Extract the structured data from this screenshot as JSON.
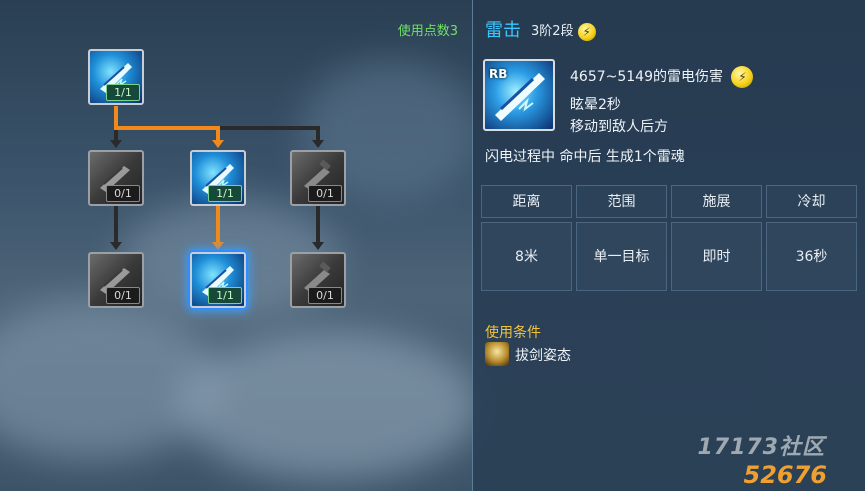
{
  "tree": {
    "points_label": "使用点数3",
    "nodes": [
      {
        "id": "root",
        "count": "1/1",
        "state": "active"
      },
      {
        "id": "r2c1",
        "count": "0/1",
        "state": "locked"
      },
      {
        "id": "r2c2",
        "count": "1/1",
        "state": "active"
      },
      {
        "id": "r2c3",
        "count": "0/1",
        "state": "locked"
      },
      {
        "id": "r3c1",
        "count": "0/1",
        "state": "locked"
      },
      {
        "id": "r3c2",
        "count": "1/1",
        "state": "active"
      },
      {
        "id": "r3c3",
        "count": "0/1",
        "state": "locked"
      }
    ]
  },
  "skill": {
    "name": "雷击",
    "level": "3阶2段",
    "key": "RB",
    "damage": "4657~5149的雷电伤害",
    "effect1": "眩晕2秒",
    "effect2": "移动到敌人后方",
    "extra": "闪电过程中 命中后 生成1个雷魂",
    "bolt_glyph": "⚡"
  },
  "stats": {
    "headers": [
      "距离",
      "范围",
      "施展",
      "冷却"
    ],
    "values": [
      "8米",
      "单一目标",
      "即时",
      "36秒"
    ]
  },
  "condition": {
    "title": "使用条件",
    "item": "拔剑姿态"
  },
  "watermark": {
    "text": "17173社区",
    "text2": "52676"
  },
  "colors": {
    "active_line": "#f08a1c",
    "inactive_line": "#2a2a2a",
    "skill_name": "#39c7ff",
    "points": "#6fe06a",
    "condition_title": "#f2c23a"
  }
}
